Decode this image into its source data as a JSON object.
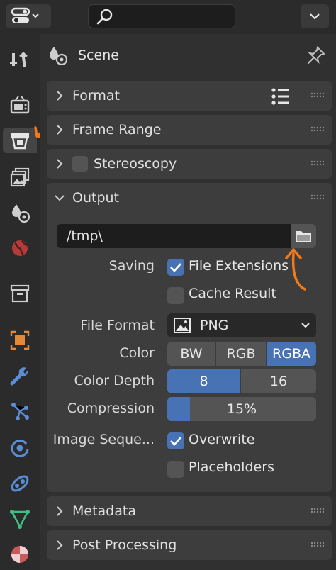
{
  "topbar": {
    "search_placeholder": ""
  },
  "header": {
    "title": "Scene"
  },
  "panels": {
    "format": "Format",
    "frame_range": "Frame Range",
    "stereoscopy": "Stereoscopy",
    "output": "Output",
    "metadata": "Metadata",
    "post_processing": "Post Processing"
  },
  "output": {
    "path": "/tmp\\",
    "saving_label": "Saving",
    "file_extensions": "File Extensions",
    "cache_result": "Cache Result",
    "file_format_label": "File Format",
    "file_format_value": "PNG",
    "color_label": "Color",
    "color_options": [
      "BW",
      "RGB",
      "RGBA"
    ],
    "color_selected": "RGBA",
    "color_depth_label": "Color Depth",
    "color_depth_options": [
      "8",
      "16"
    ],
    "color_depth_selected": "8",
    "compression_label": "Compression",
    "compression_value": "15%",
    "compression_fraction": 0.15,
    "image_sequence_label": "Image Seque...",
    "overwrite": "Overwrite",
    "placeholders": "Placeholders"
  },
  "colors": {
    "accent": "#4772b3",
    "panel": "#3d3d3d",
    "annotation": "#f07a1a"
  }
}
